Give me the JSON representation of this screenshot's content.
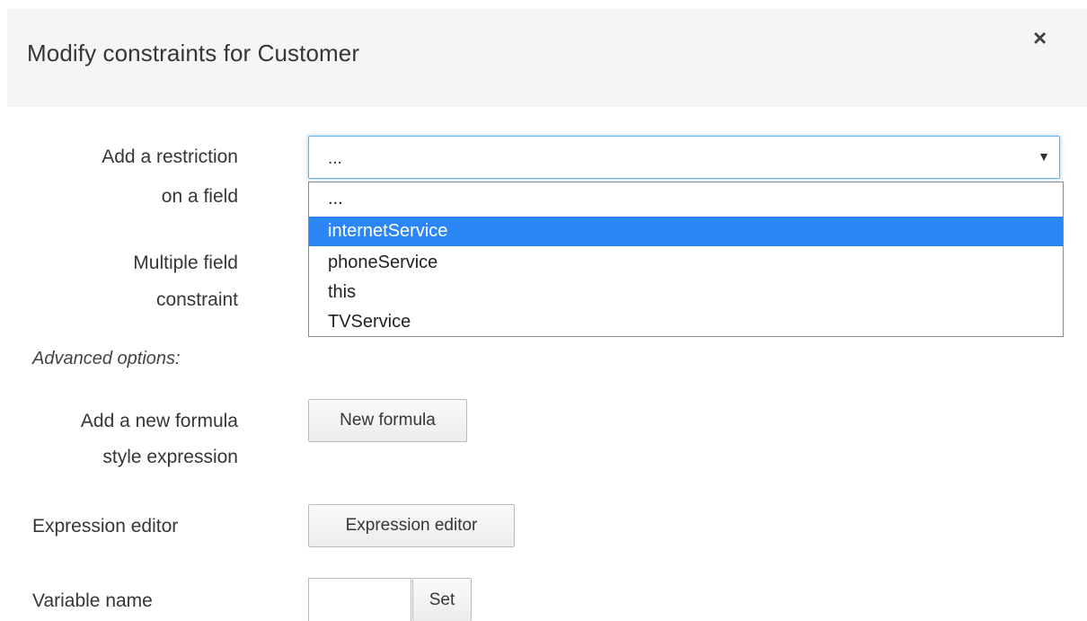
{
  "dialog": {
    "title": "Modify constraints for Customer",
    "close_symbol": "×"
  },
  "restriction": {
    "label_line1": "Add a restriction",
    "label_line2": "on a field",
    "selected_value": "...",
    "caret": "▼",
    "options": [
      "...",
      "internetService",
      "phoneService",
      "this",
      "TVService"
    ],
    "highlighted_option": "internetService"
  },
  "multiple": {
    "label_line1": "Multiple field",
    "label_line2": "constraint"
  },
  "advanced": {
    "label": "Advanced options:"
  },
  "formula": {
    "label_line1": "Add a new formula",
    "label_line2": "style expression",
    "button_label": "New formula"
  },
  "expression": {
    "label": "Expression editor",
    "button_label": "Expression editor"
  },
  "variable": {
    "label": "Variable name",
    "input_value": "",
    "button_label": "Set"
  },
  "colors": {
    "header_bg": "#f5f5f5",
    "focus_border": "#66afe9",
    "highlight": "#2c86f6"
  }
}
